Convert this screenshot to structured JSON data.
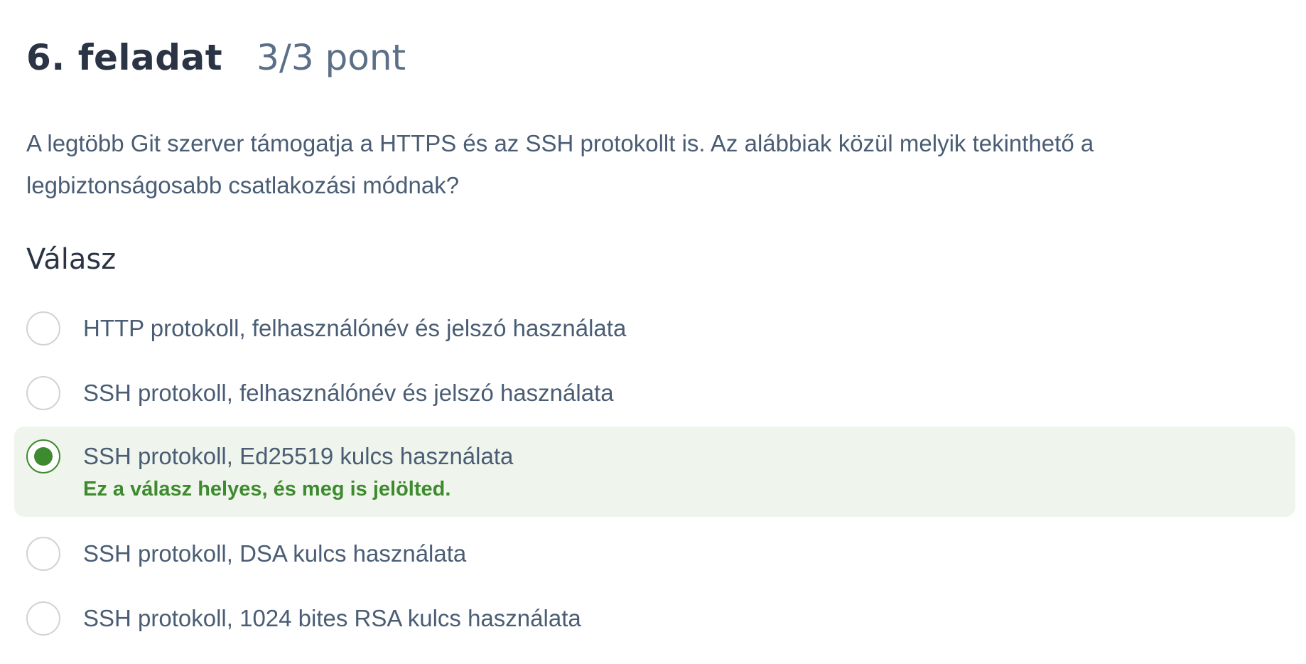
{
  "task": {
    "title": "6. feladat",
    "points": "3/3 pont"
  },
  "question": "A legtöbb Git szerver támogatja a HTTPS és az SSH protokollt is. Az alábbiak közül melyik tekinthető a legbiztonságosabb csatlakozási módnak?",
  "answer_heading": "Válasz",
  "options": [
    {
      "label": "HTTP protokoll, felhasználónév és jelszó használata",
      "selected": false
    },
    {
      "label": "SSH protokoll, felhasználónév és jelszó használata",
      "selected": false
    },
    {
      "label": "SSH protokoll, Ed25519 kulcs használata",
      "selected": true,
      "feedback": "Ez a válasz helyes, és meg is jelölted."
    },
    {
      "label": "SSH protokoll, DSA kulcs használata",
      "selected": false
    },
    {
      "label": "SSH protokoll, 1024 bites RSA kulcs használata",
      "selected": false
    }
  ],
  "colors": {
    "correct": "#3d8b2e",
    "correct_bg": "#eff5ec",
    "text": "#4a5d74",
    "heading": "#2b3444"
  }
}
